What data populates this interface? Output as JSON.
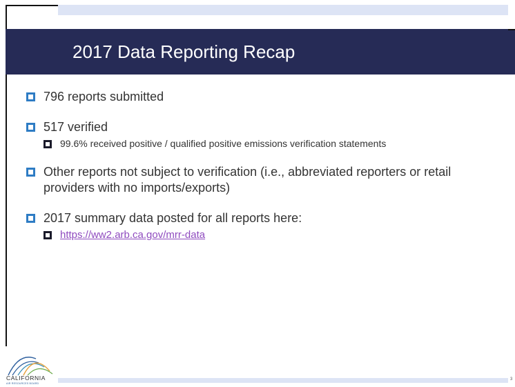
{
  "slide": {
    "title": "2017 Data Reporting Recap",
    "page_number": "3"
  },
  "bullets": [
    {
      "text": "796 reports submitted"
    },
    {
      "text": "517 verified",
      "sub": [
        {
          "text": "99.6% received positive / qualified positive emissions verification statements"
        }
      ]
    },
    {
      "text": "Other reports not subject to verification (i.e., abbreviated reporters or retail providers with no imports/exports)"
    },
    {
      "text": "2017 summary data posted for all reports here:",
      "sub": [
        {
          "text": "https://ww2.arb.ca.gov/mrr-data",
          "is_link": true
        }
      ]
    }
  ],
  "logo": {
    "name": "CALIFORNIA",
    "tagline": "AIR RESOURCES BOARD"
  },
  "colors": {
    "title_bar": "#262b56",
    "bullet_accent": "#2e7cc4",
    "band": "#dde4f5",
    "link": "#8f4bbf"
  }
}
